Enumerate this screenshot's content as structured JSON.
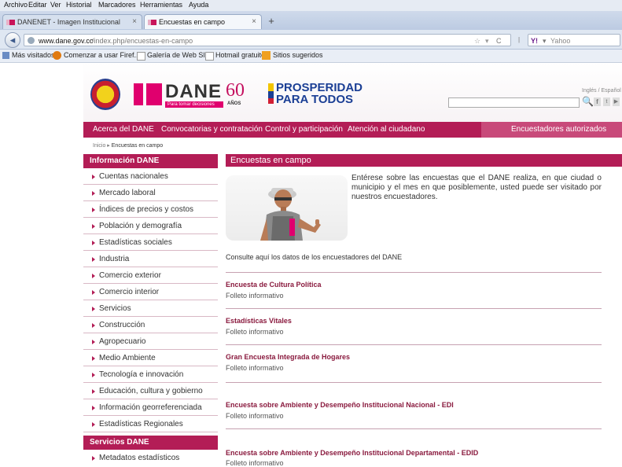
{
  "browser": {
    "menu": [
      "Archivo",
      "Editar",
      "Ver",
      "Historial",
      "Marcadores",
      "Herramientas",
      "Ayuda"
    ],
    "tabs": [
      {
        "label": "DANENET - Imagen Institucional"
      },
      {
        "label": "Encuestas en campo"
      }
    ],
    "new_tab": "+",
    "url_domain": "www.dane.gov.co",
    "url_path": "/index.php/encuestas-en-campo",
    "search_engine": "Yahoo",
    "bookmarks": [
      "Más visitados",
      "Comenzar a usar Firef...",
      "Galería de Web Slice",
      "Hotmail gratuito",
      "Sitios sugeridos"
    ]
  },
  "header": {
    "dane_logo": "DANE",
    "dane_tagline": "Para tomar decisiones",
    "anniversary": "60",
    "anniversary_word": "AÑOS",
    "prosperidad_line1": "PROSPERIDAD",
    "prosperidad_line2": "PARA TODOS",
    "language_links": "Inglés / Español"
  },
  "topnav": {
    "items": [
      "Acerca del DANE",
      "Convocatorias y contratación",
      "Control y participación",
      "Atención al ciudadano"
    ],
    "authorized": "Encuestadores autorizados"
  },
  "breadcrumb": {
    "home": "Inicio",
    "separator": "▸",
    "current": "Encuestas en campo"
  },
  "sidebar": {
    "section1_title": "Información DANE",
    "items": [
      "Cuentas nacionales",
      "Mercado laboral",
      "Índices de precios y costos",
      "Población y demografía",
      "Estadísticas sociales",
      "Industria",
      "Comercio exterior",
      "Comercio interior",
      "Servicios",
      "Construcción",
      "Agropecuario",
      "Medio Ambiente",
      "Tecnología e innovación",
      "Educación, cultura y gobierno",
      "Información georreferenciada",
      "Estadísticas Regionales"
    ],
    "section2_title": "Servicios DANE",
    "section2_items": [
      "Metadatos estadísticos"
    ]
  },
  "content": {
    "title": "Encuestas en campo",
    "intro": "Entérese sobre las encuestas que el DANE realiza, en que ciudad o municipio y el mes en que posiblemente, usted puede ser visitado por nuestros encuestadores.",
    "consult": "Consulte aquí los datos de los encuestadores del DANE",
    "surveys": [
      {
        "title": "Encuesta de Cultura Política",
        "sub": "Folleto informativo"
      },
      {
        "title": "Estadísticas Vitales",
        "sub": "Folleto informativo"
      },
      {
        "title": "Gran Encuesta Integrada de Hogares",
        "sub": "Folleto informativo"
      },
      {
        "title": "Encuesta sobre Ambiente y Desempeño Institucional Nacional - EDI",
        "sub": "Folleto informativo"
      },
      {
        "title": "Encuesta sobre Ambiente y Desempeño Institucional Departamental - EDID",
        "sub": "Folleto informativo"
      }
    ]
  },
  "colors": {
    "brand": "#b31d56",
    "brand_light": "#c84a7a",
    "link": "#8a1a3e",
    "pink": "#e0006e"
  }
}
